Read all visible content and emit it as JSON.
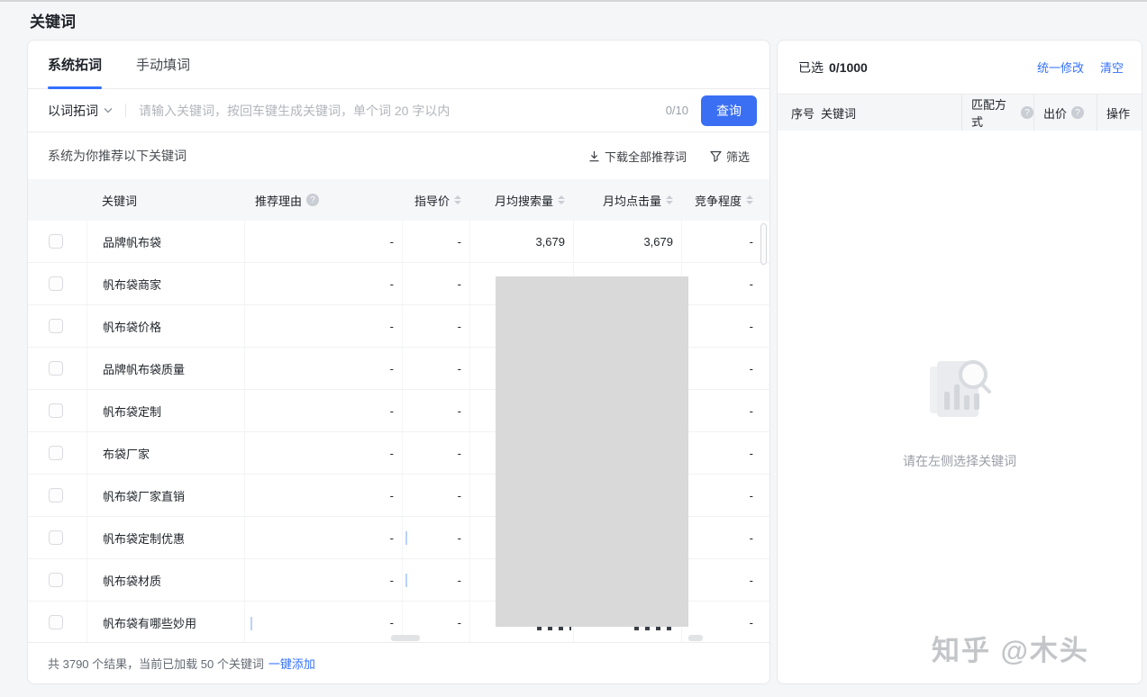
{
  "page": {
    "title": "关键词"
  },
  "colors": {
    "accent": "#3370FF",
    "button": "#3B6FF3",
    "redaction": "#D9D9D9"
  },
  "left_panel": {
    "tabs": [
      {
        "label": "系统拓词",
        "active": true
      },
      {
        "label": "手动填词",
        "active": false
      }
    ],
    "search": {
      "mode": "以词拓词",
      "placeholder": "请输入关键词，按回车键生成关键词，单个词 20 字以内",
      "counter": "0/10",
      "button": "查询"
    },
    "recommend_bar": {
      "title": "系统为你推荐以下关键词",
      "download": "下载全部推荐词",
      "filter": "筛选"
    },
    "table": {
      "headers": [
        "关键词",
        "推荐理由",
        "指导价",
        "月均搜索量",
        "月均点击量",
        "竞争程度"
      ],
      "rows": [
        {
          "keyword": "品牌帆布袋",
          "reason": "-",
          "price": "-",
          "search": "3,679",
          "click": "3,679",
          "competition": "-"
        },
        {
          "keyword": "帆布袋商家",
          "reason": "-",
          "price": "-",
          "search": "",
          "click": "",
          "competition": "-"
        },
        {
          "keyword": "帆布袋价格",
          "reason": "-",
          "price": "-",
          "search": "",
          "click": "",
          "competition": "-"
        },
        {
          "keyword": "品牌帆布袋质量",
          "reason": "-",
          "price": "-",
          "search": "",
          "click": "",
          "competition": "-"
        },
        {
          "keyword": "帆布袋定制",
          "reason": "-",
          "price": "-",
          "search": "",
          "click": "",
          "competition": "-"
        },
        {
          "keyword": "布袋厂家",
          "reason": "-",
          "price": "-",
          "search": "",
          "click": "",
          "competition": "-"
        },
        {
          "keyword": "帆布袋厂家直销",
          "reason": "-",
          "price": "-",
          "search": "",
          "click": "",
          "competition": "-"
        },
        {
          "keyword": "帆布袋定制优惠",
          "reason": "-",
          "price": "-",
          "search": "",
          "click": "",
          "competition": "-"
        },
        {
          "keyword": "帆布袋材质",
          "reason": "-",
          "price": "-",
          "search": "",
          "click": "",
          "competition": "-"
        },
        {
          "keyword": "帆布袋有哪些妙用",
          "reason": "-",
          "price": "-",
          "search": "",
          "click": "",
          "competition": "-"
        }
      ]
    },
    "footer": {
      "summary": "共 3790 个结果，当前已加载 50 个关键词",
      "add_all": "一键添加"
    }
  },
  "right_panel": {
    "selected_label": "已选",
    "selected_count": "0/1000",
    "batch_edit": "统一修改",
    "clear": "清空",
    "headers": [
      "序号",
      "关键词",
      "匹配方式",
      "出价",
      "操作"
    ],
    "empty_text": "请在左侧选择关键词"
  },
  "watermark": "知乎 @木头"
}
